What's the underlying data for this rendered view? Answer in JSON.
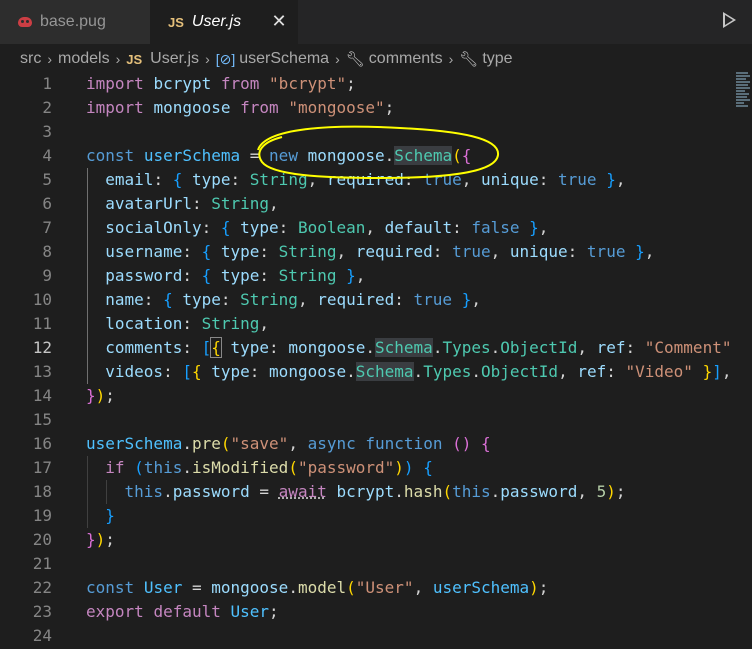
{
  "tabs": [
    {
      "label": "base.pug",
      "icon": "pug-icon",
      "active": false
    },
    {
      "label": "User.js",
      "icon_text": "JS",
      "active": true
    }
  ],
  "breadcrumb": {
    "items": [
      "src",
      "models",
      "User.js",
      "userSchema",
      "comments",
      "type"
    ],
    "js_icon_text": "JS"
  },
  "editor": {
    "current_line": 12,
    "line_numbers": [
      "1",
      "2",
      "3",
      "4",
      "5",
      "6",
      "7",
      "8",
      "9",
      "10",
      "11",
      "12",
      "13",
      "14",
      "15",
      "16",
      "17",
      "18",
      "19",
      "20",
      "21",
      "22",
      "23",
      "24"
    ]
  },
  "colors": {
    "background": "#1e1e1e",
    "keyword": "#c586c0",
    "storage": "#569cd6",
    "variable": "#9cdcfe",
    "string": "#ce9178",
    "type": "#4ec9b0",
    "function": "#dcdcaa",
    "annotation": "#ffff00"
  }
}
